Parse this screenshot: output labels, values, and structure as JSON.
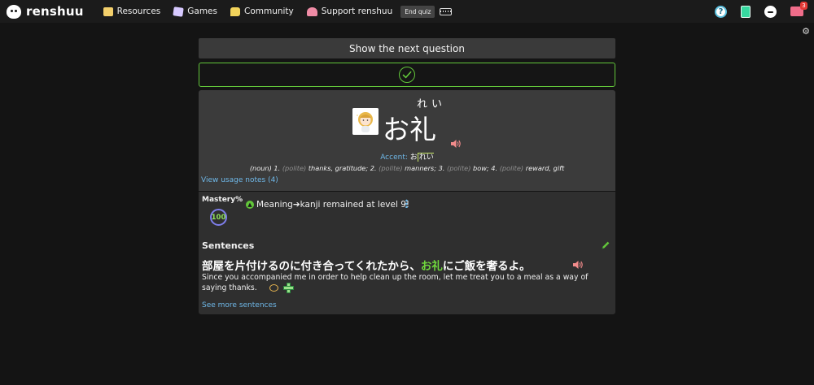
{
  "header": {
    "brand": "renshuu",
    "nav": [
      {
        "label": "Resources",
        "icon": "book-icon"
      },
      {
        "label": "Games",
        "icon": "dice-icon"
      },
      {
        "label": "Community",
        "icon": "chat-bubble-icon"
      },
      {
        "label": "Support renshuu",
        "icon": "heart-icon"
      }
    ],
    "end_quiz_label": "End quiz",
    "help_glyph": "?",
    "mail_badge": "3"
  },
  "quiz": {
    "next_question_label": "Show the next question",
    "result": "correct"
  },
  "word": {
    "furigana": "れい",
    "kanji": "お礼",
    "accent_label": "Accent:",
    "accent_prefix": "お",
    "accent_high": "れい",
    "pos": "(noun)",
    "definitions": [
      {
        "num": "1.",
        "register": "(polite)",
        "text": "thanks, gratitude;"
      },
      {
        "num": "2.",
        "register": "(polite)",
        "text": "manners;"
      },
      {
        "num": "3.",
        "register": "(polite)",
        "text": "bow;"
      },
      {
        "num": "4.",
        "register": "(polite)",
        "text": "reward, gift"
      }
    ],
    "usage_notes_link": "View usage notes (4)"
  },
  "mastery": {
    "label": "Mastery%",
    "value": "100",
    "message": "Meaning➔kanji remained at level 9!"
  },
  "sentences": {
    "title": "Sentences",
    "jp_before": "部屋を片付けるのに付き合ってくれたから、",
    "jp_highlight": "お礼",
    "jp_after": "にご飯を奢るよ。",
    "en": "Since you accompanied me in order to help clean up the room, let me treat you to a meal as a way of saying thanks.",
    "more_link": "See more sentences"
  },
  "colors": {
    "accent_green": "#62c63a",
    "link_blue": "#6fb8e8",
    "highlight_green": "#6fd63c"
  }
}
